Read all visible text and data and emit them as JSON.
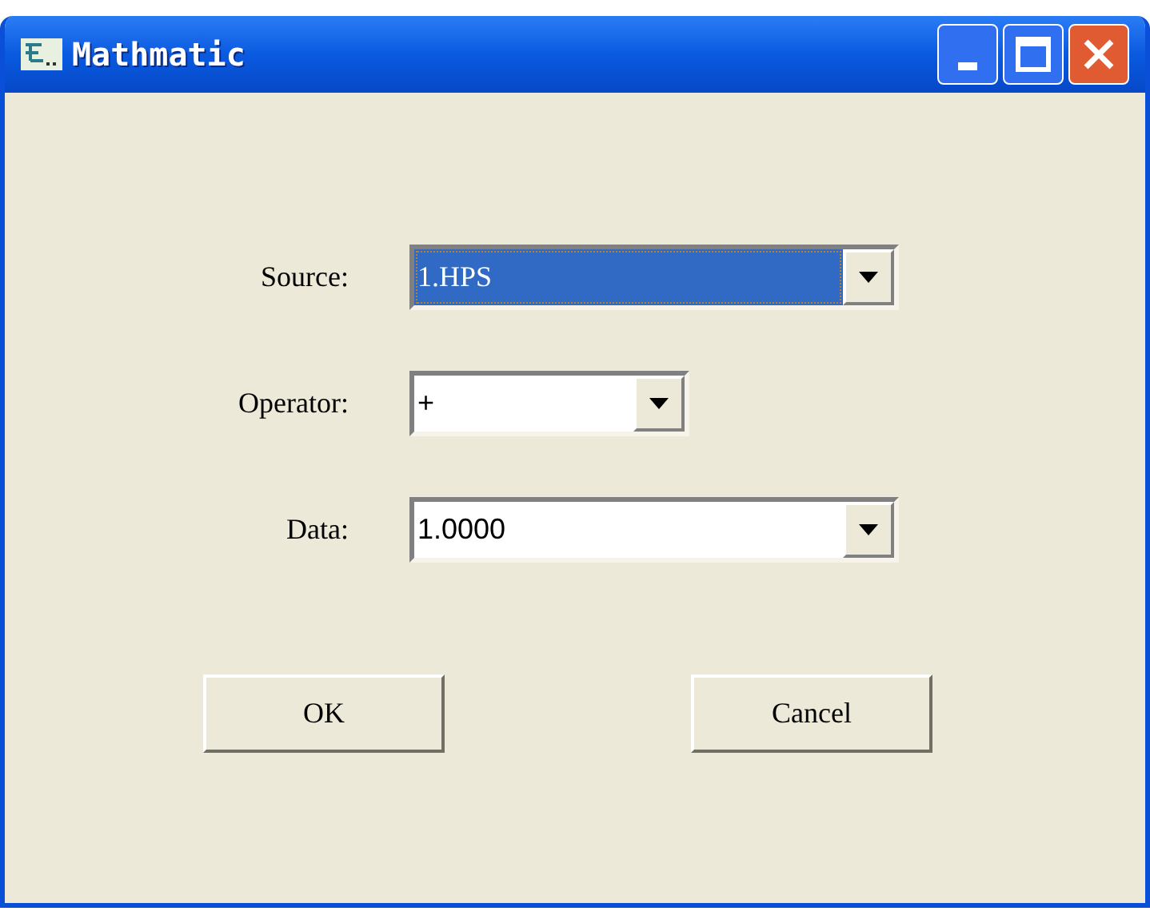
{
  "window": {
    "title": "Mathmatic"
  },
  "fields": [
    {
      "label": "Source:",
      "value": "1.HPS",
      "selected": true,
      "kind": "wide"
    },
    {
      "label": "Operator:",
      "value": "+",
      "selected": false,
      "kind": "narrow"
    },
    {
      "label": "Data:",
      "value": "1.0000",
      "selected": false,
      "kind": "wide"
    }
  ],
  "buttons": [
    "OK",
    "Cancel"
  ]
}
